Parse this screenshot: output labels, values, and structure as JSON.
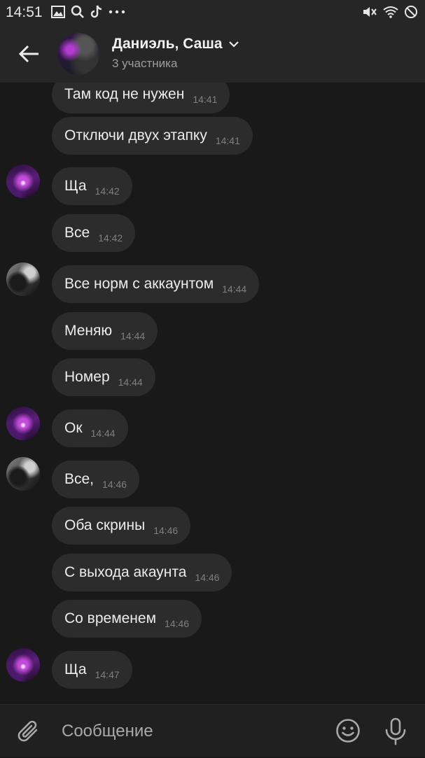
{
  "status_bar": {
    "time": "14:51",
    "icons_left": [
      "gallery-icon",
      "search-icon",
      "tiktok-icon",
      "more-dots-icon"
    ],
    "icons_right": [
      "mute-icon",
      "wifi-icon",
      "do-not-disturb-icon"
    ]
  },
  "header": {
    "title": "Даниэль, Саша",
    "subtitle": "3 участника"
  },
  "messages": [
    {
      "text": "Там код не нужен",
      "time": "14:41",
      "avatar": ""
    },
    {
      "text": "Отключи двух этапку",
      "time": "14:41",
      "avatar": ""
    },
    {
      "text": "Ща",
      "time": "14:42",
      "avatar": "purple"
    },
    {
      "text": "Все",
      "time": "14:42",
      "avatar": ""
    },
    {
      "text": "Все норм с аккаунтом",
      "time": "14:44",
      "avatar": "dark"
    },
    {
      "text": "Меняю",
      "time": "14:44",
      "avatar": ""
    },
    {
      "text": "Номер",
      "time": "14:44",
      "avatar": ""
    },
    {
      "text": "Ок",
      "time": "14:44",
      "avatar": "purple"
    },
    {
      "text": "Все,",
      "time": "14:46",
      "avatar": "dark"
    },
    {
      "text": "Оба скрины",
      "time": "14:46",
      "avatar": ""
    },
    {
      "text": "С выхода акаунта",
      "time": "14:46",
      "avatar": ""
    },
    {
      "text": "Со временем",
      "time": "14:46",
      "avatar": ""
    },
    {
      "text": "Ща",
      "time": "14:47",
      "avatar": "purple"
    }
  ],
  "composer": {
    "placeholder": "Сообщение"
  }
}
